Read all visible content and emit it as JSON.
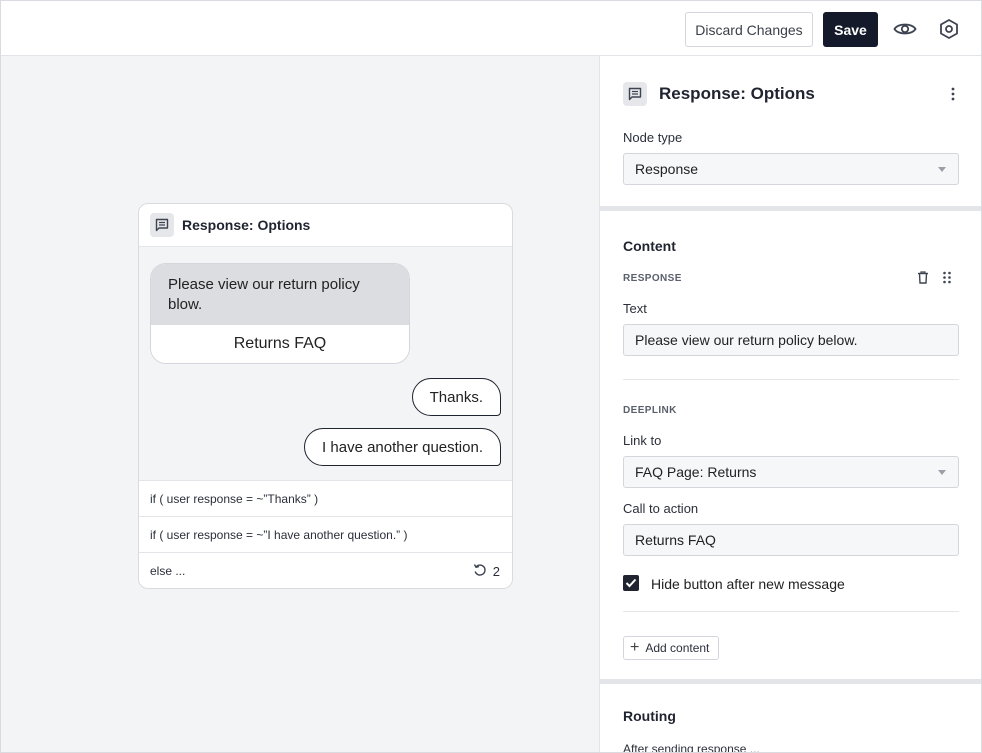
{
  "toolbar": {
    "discard_label": "Discard Changes",
    "save_label": "Save",
    "preview_icon": "eye-icon",
    "settings_icon": "hexagon-settings-icon"
  },
  "canvas": {
    "node": {
      "icon": "chat-message-icon",
      "title": "Response: Options",
      "bot_message": "Please view our return policy blow.",
      "bot_cta": "Returns FAQ",
      "user_replies": [
        "Thanks.",
        "I have another question."
      ],
      "routes": [
        "if ( user response = ~”Thanks” )",
        "if ( user response = ~”I have another question.” )",
        "else ..."
      ],
      "loop_count": "2",
      "loop_icon": "loop-arrow-icon"
    }
  },
  "panel": {
    "icon": "chat-message-icon",
    "title": "Response: Options",
    "menu_icon": "kebab-menu-icon",
    "node_type_label": "Node type",
    "node_type_value": "Response",
    "content_heading": "Content",
    "response_subheading": "RESPONSE",
    "delete_icon": "trash-icon",
    "drag_icon": "drag-handle-icon",
    "text_label": "Text",
    "text_value": "Please view our return policy below.",
    "deeplink_subheading": "DEEPLINK",
    "link_to_label": "Link to",
    "link_to_value": "FAQ Page: Returns",
    "cta_label": "Call to action",
    "cta_value": "Returns FAQ",
    "hide_button_label": "Hide button after new message",
    "hide_button_checked": true,
    "add_content_label": "Add content",
    "routing_heading": "Routing",
    "routing_subtext": "After sending response ..."
  }
}
